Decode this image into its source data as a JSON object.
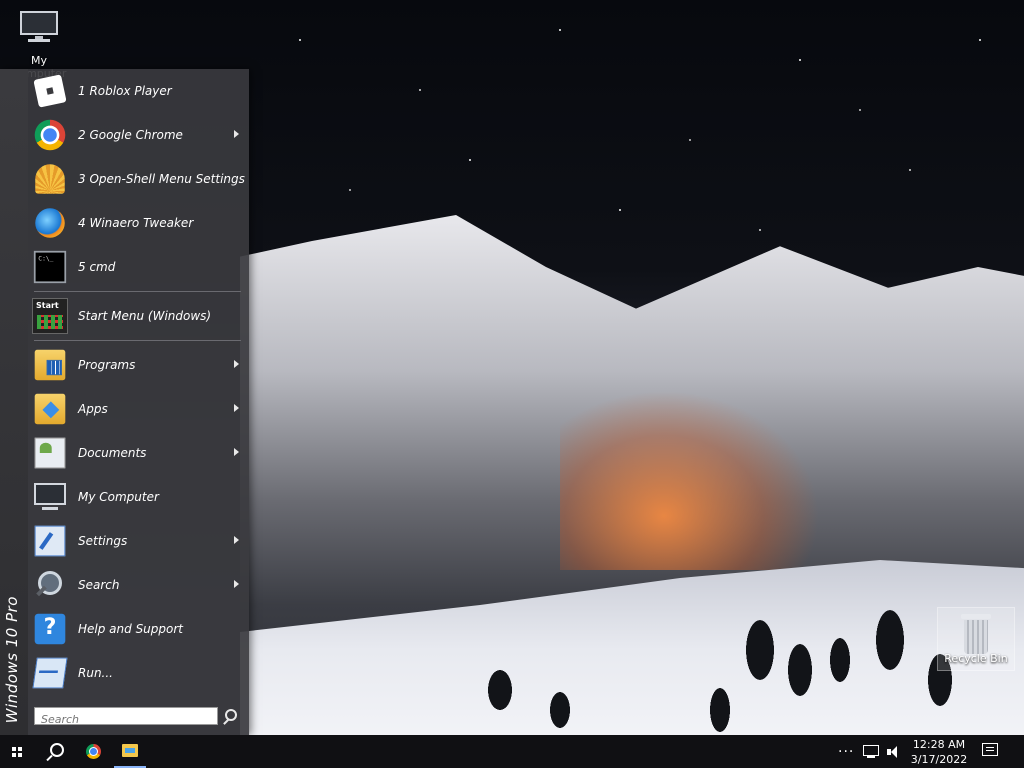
{
  "desktop": {
    "icons": [
      {
        "label": "My Computer"
      },
      {
        "label": "Recycle Bin"
      }
    ]
  },
  "start_menu": {
    "banner": "Windows 10 Pro",
    "recent": [
      {
        "label": "1 Roblox Player",
        "icon": "roblox-icon",
        "submenu": false
      },
      {
        "label": "2 Google Chrome",
        "icon": "chrome-icon",
        "submenu": true
      },
      {
        "label": "3 Open-Shell Menu Settings",
        "icon": "open-shell-icon",
        "submenu": false
      },
      {
        "label": "4 Winaero Tweaker",
        "icon": "winaero-icon",
        "submenu": false
      },
      {
        "label": "5 cmd",
        "icon": "cmd-icon",
        "submenu": false
      }
    ],
    "windows_start": {
      "label": "Start Menu (Windows)",
      "icon": "start-menu-icon"
    },
    "main": [
      {
        "label": "Programs",
        "icon": "programs-icon",
        "submenu": true
      },
      {
        "label": "Apps",
        "icon": "apps-icon",
        "submenu": true
      },
      {
        "label": "Documents",
        "icon": "documents-icon",
        "submenu": true
      },
      {
        "label": "My Computer",
        "icon": "computer-icon",
        "submenu": false
      },
      {
        "label": "Settings",
        "icon": "settings-icon",
        "submenu": true
      },
      {
        "label": "Search",
        "icon": "search-icon",
        "submenu": true
      },
      {
        "label": "Help and Support",
        "icon": "help-icon",
        "submenu": false
      },
      {
        "label": "Run...",
        "icon": "run-icon",
        "submenu": false
      }
    ],
    "search_placeholder": "Search"
  },
  "taskbar": {
    "tray_more": "···",
    "time": "12:28 AM",
    "date": "3/17/2022"
  }
}
